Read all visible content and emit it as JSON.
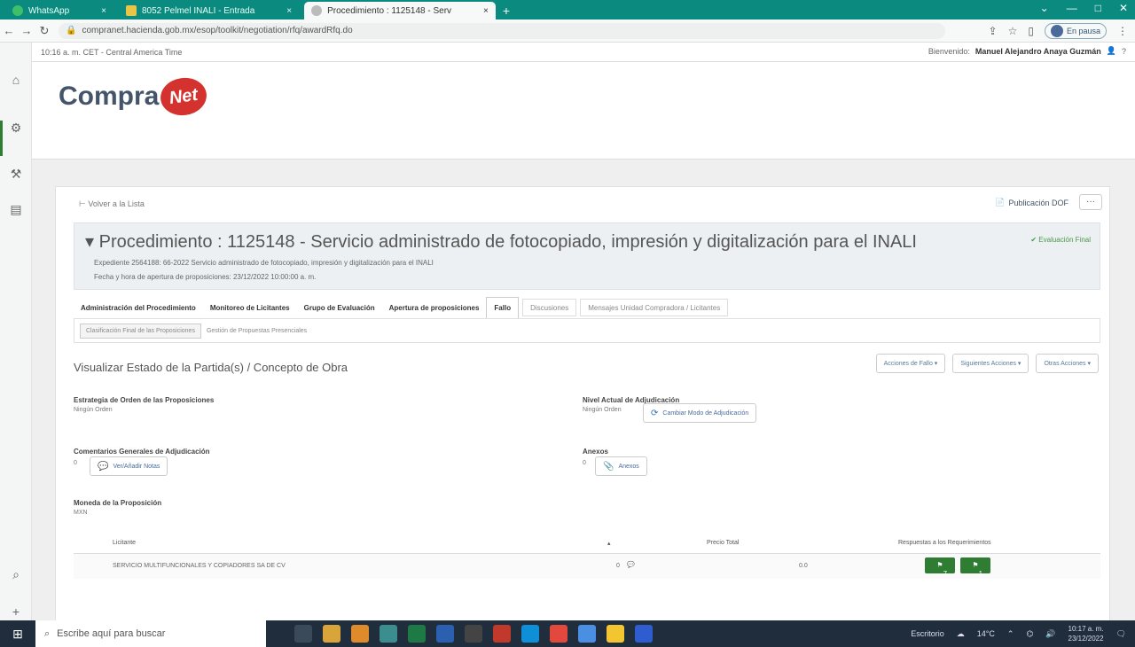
{
  "browser": {
    "tabs": [
      {
        "label": "WhatsApp",
        "close": "×"
      },
      {
        "label": "8052 Pelmel INALI - Entrada",
        "close": "×"
      },
      {
        "label": "Procedimiento : 1125148 - Serv",
        "close": "×"
      }
    ],
    "new_tab": "+",
    "url": "compranet.hacienda.gob.mx/esop/toolkit/negotiation/rfq/awardRfq.do",
    "profile_label": "En pausa"
  },
  "page": {
    "time_line": "10:16 a. m. CET - Central America Time",
    "welcome_prefix": "Bienvenido:",
    "welcome_user": "Manuel Alejandro Anaya Guzmán",
    "logo_text": "Compra",
    "logo_net": "Net",
    "back_link": "Volver a la Lista",
    "pub_dof": "Publicación DOF",
    "more": "···",
    "proc_title": "Procedimiento : 1125148 - Servicio administrado de fotocopiado, impresión y digitalización para el INALI",
    "proc_expediente": "Expediente 2564188: 66-2022 Servicio administrado de fotocopiado, impresión y digitalización para el INALI",
    "proc_fecha": "Fecha y hora de apertura de proposiciones: 23/12/2022 10:00:00 a. m.",
    "eval_final": "Evaluación Final",
    "tabs": [
      "Administración del Procedimiento",
      "Monitoreo de Licitantes",
      "Grupo de Evaluación",
      "Apertura de proposiciones",
      "Fallo",
      "Discusiones",
      "Mensajes Unidad Compradora / Licitantes"
    ],
    "subtabs": [
      "Clasificación Final de las Proposiciones",
      "Gestión de Propuestas Presenciales"
    ],
    "section_title": "Visualizar Estado de la Partida(s) / Concepto de Obra",
    "action_buttons": [
      "Acciones de Fallo",
      "Siguientes Acciones",
      "Otras Acciones"
    ],
    "fields": {
      "estrategia_label": "Estrategia de Orden de las Proposiciones",
      "estrategia_val": "Ningún Orden",
      "nivel_label": "Nivel Actual de Adjudicación",
      "nivel_val": "Ningún Orden",
      "cambiar_btn": "Cambiar Modo de Adjudicación",
      "comentarios_label": "Comentarios Generales de Adjudicación",
      "comentarios_count": "0",
      "notas_btn": "Ver/Añadir Notas",
      "anexos_label": "Anexos",
      "anexos_count": "0",
      "anexos_btn": "Anexos",
      "moneda_label": "Moneda de la Proposición",
      "moneda_val": "MXN"
    },
    "table": {
      "headers": [
        "Licitante",
        "Precio Total",
        "Respuestas a los Requerimientos"
      ],
      "rows": [
        {
          "licitante": "SERVICIO MULTIFUNCIONALES Y COPIADORES SA DE CV",
          "notas": "0",
          "precio": "0.0",
          "btn1": "7",
          "btn2": "1"
        }
      ]
    }
  },
  "taskbar": {
    "search_placeholder": "Escribe aquí para buscar",
    "tray_app": "Escritorio",
    "temp": "14°C",
    "time": "10:17 a. m.",
    "date": "23/12/2022"
  }
}
